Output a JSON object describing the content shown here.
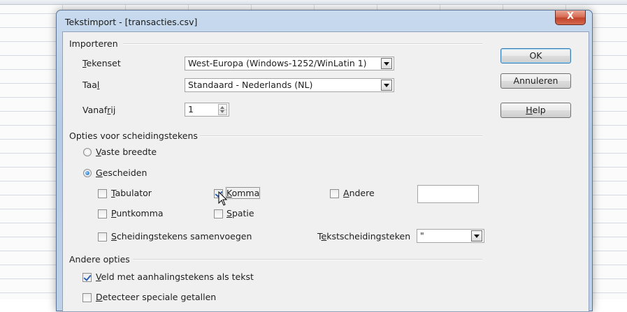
{
  "window": {
    "title": "Tekstimport - [transacties.csv]",
    "close_glyph": "X"
  },
  "importeren": {
    "heading": "Importeren",
    "tekenset": {
      "label_ul": "T",
      "label_rest": "ekenset",
      "value": "West-Europa (Windows-1252/WinLatin 1)"
    },
    "taal": {
      "label_pre": "Taa",
      "label_ul": "l",
      "value": "Standaard - Nederlands (NL)"
    },
    "vanaf_rij": {
      "label_pre": "Vanaf",
      "label_ul": "r",
      "label_rest": "ij",
      "value": "1"
    }
  },
  "scheiding": {
    "heading": "Opties voor scheidingstekens",
    "vaste_breedte": {
      "ul": "V",
      "rest": "aste breedte",
      "selected": false
    },
    "gescheiden": {
      "ul": "G",
      "rest": "escheiden",
      "selected": true
    },
    "tabulator": {
      "ul": "T",
      "rest": "abulator",
      "checked": false
    },
    "komma": {
      "ul": "K",
      "rest": "omma",
      "checked": true
    },
    "andere": {
      "ul": "A",
      "rest": "ndere",
      "checked": false,
      "value": ""
    },
    "puntkomma": {
      "ul": "P",
      "rest": "untkomma",
      "checked": false
    },
    "spatie": {
      "ul": "S",
      "rest": "patie",
      "checked": false
    },
    "samenvoegen": {
      "ul": "S",
      "rest": "cheidingstekens samenvoegen",
      "checked": false
    },
    "tekstscheiding": {
      "label_pre": "T",
      "label_ul": "e",
      "label_rest": "kstscheidingsteken",
      "value": "\""
    }
  },
  "andere_opties": {
    "heading": "Andere opties",
    "veld": {
      "ul": "V",
      "rest": "eld met aanhalingstekens als tekst",
      "checked": true
    },
    "detecteer": {
      "ul": "D",
      "rest": "etecteer speciale getallen",
      "checked": false
    }
  },
  "buttons": {
    "ok": "OK",
    "annuleren": "Annuleren",
    "help_ul": "H",
    "help_rest": "elp"
  }
}
